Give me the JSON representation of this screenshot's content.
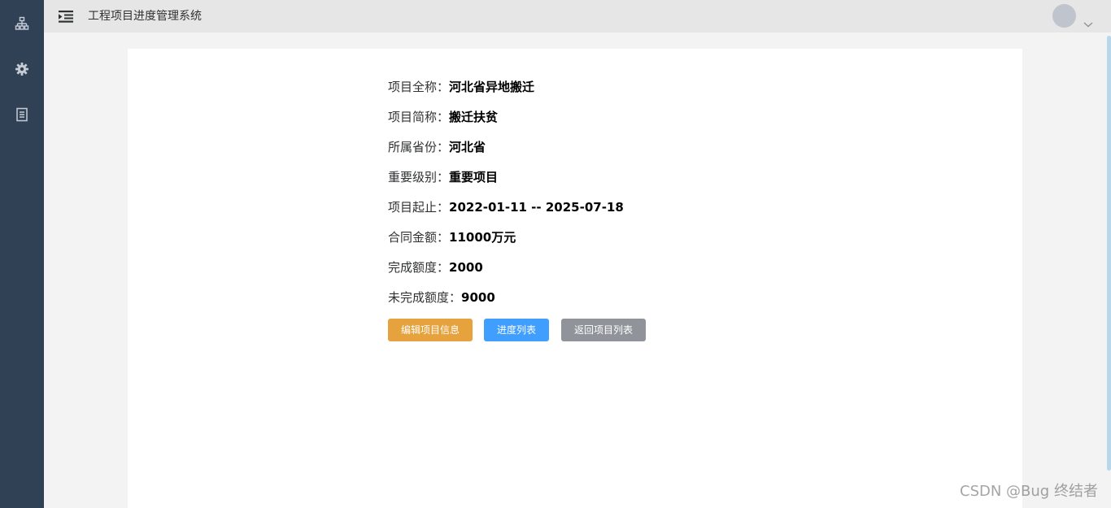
{
  "header": {
    "title": "工程项目进度管理系统"
  },
  "sidebar": {
    "items": [
      {
        "icon": "sitemap-icon"
      },
      {
        "icon": "gear-icon"
      },
      {
        "icon": "document-icon"
      }
    ]
  },
  "project": {
    "full_name_label": "项目全称：",
    "full_name": "河北省异地搬迁",
    "short_name_label": "项目简称：",
    "short_name": "搬迁扶贫",
    "province_label": "所属省份：",
    "province": "河北省",
    "level_label": "重要级别：",
    "level": "重要项目",
    "period_label": "项目起止：",
    "period": "2022-01-11 -- 2025-07-18",
    "amount_label": "合同金额：",
    "amount": "11000万元",
    "completed_label": "完成额度：",
    "completed": "2000",
    "remaining_label": "未完成额度：",
    "remaining": "9000"
  },
  "actions": {
    "edit_label": "编辑项目信息",
    "progress_label": "进度列表",
    "back_label": "返回项目列表"
  },
  "watermark": {
    "text": "CSDN @Bug 终结者"
  },
  "colors": {
    "sidebar_bg": "#304156",
    "topbar_bg": "#e6e6e6",
    "edit_button": "#e6a23c",
    "progress_button": "#409eff",
    "back_button": "#909399"
  }
}
